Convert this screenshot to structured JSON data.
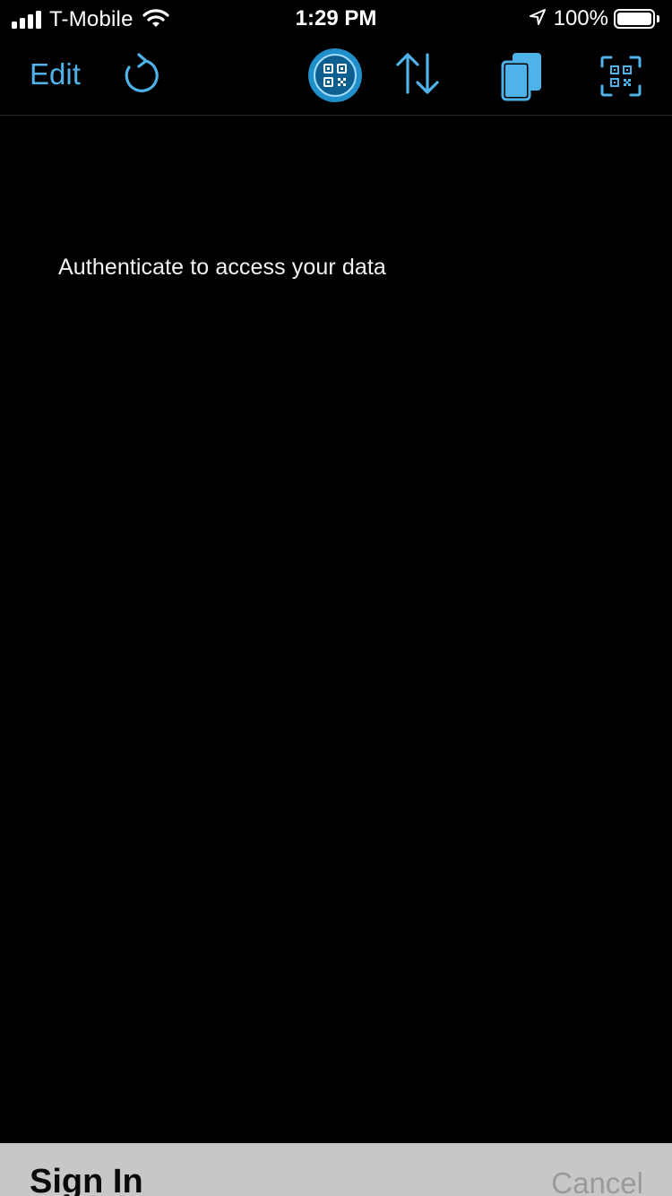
{
  "status_bar": {
    "carrier": "T-Mobile",
    "time": "1:29 PM",
    "battery_percent": "100%",
    "battery_level": 1.0,
    "icons": [
      "signal-icon",
      "wifi-icon",
      "location-arrow-icon",
      "battery-icon"
    ]
  },
  "nav": {
    "edit_label": "Edit",
    "icons": [
      "refresh-icon",
      "qr-code-circle-icon",
      "sort-arrows-icon",
      "copy-icon",
      "scan-qr-icon"
    ],
    "accent_color": "#4fb3ea"
  },
  "main": {
    "message": "Authenticate to access your data"
  },
  "sheet": {
    "title": "Sign In",
    "cancel_label": "Cancel"
  }
}
